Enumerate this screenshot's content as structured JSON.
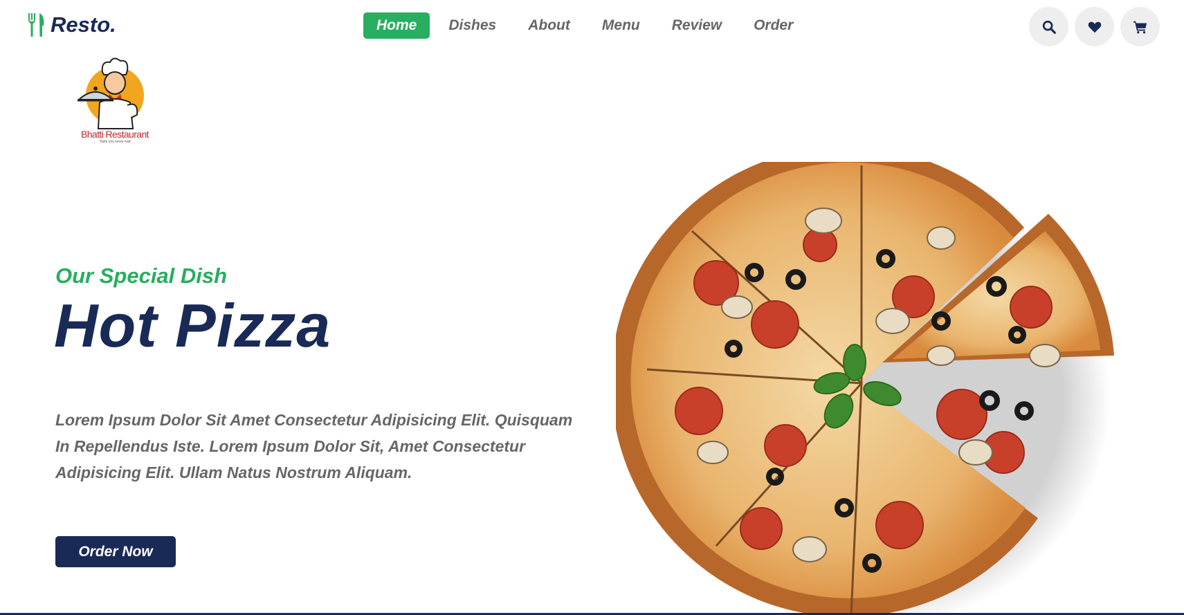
{
  "brand": {
    "name": "Resto.",
    "icon": "utensils-icon",
    "accent": "#27ae60",
    "primary": "#192a56"
  },
  "nav": {
    "items": [
      {
        "label": "Home",
        "active": true
      },
      {
        "label": "Dishes",
        "active": false
      },
      {
        "label": "About",
        "active": false
      },
      {
        "label": "Menu",
        "active": false
      },
      {
        "label": "Review",
        "active": false
      },
      {
        "label": "Order",
        "active": false
      }
    ]
  },
  "header_icons": [
    "search-icon",
    "heart-icon",
    "cart-icon"
  ],
  "badge": {
    "name": "Bhatti Restaurant",
    "tagline": "Taste you never had"
  },
  "hero": {
    "subtitle": "Our Special Dish",
    "title": "Hot Pizza",
    "description": "Lorem Ipsum Dolor Sit Amet Consectetur Adipisicing Elit. Quisquam In Repellendus Iste. Lorem Ipsum Dolor Sit, Amet Consectetur Adipisicing Elit. Ullam Natus Nostrum Aliquam.",
    "button": "Order Now"
  }
}
